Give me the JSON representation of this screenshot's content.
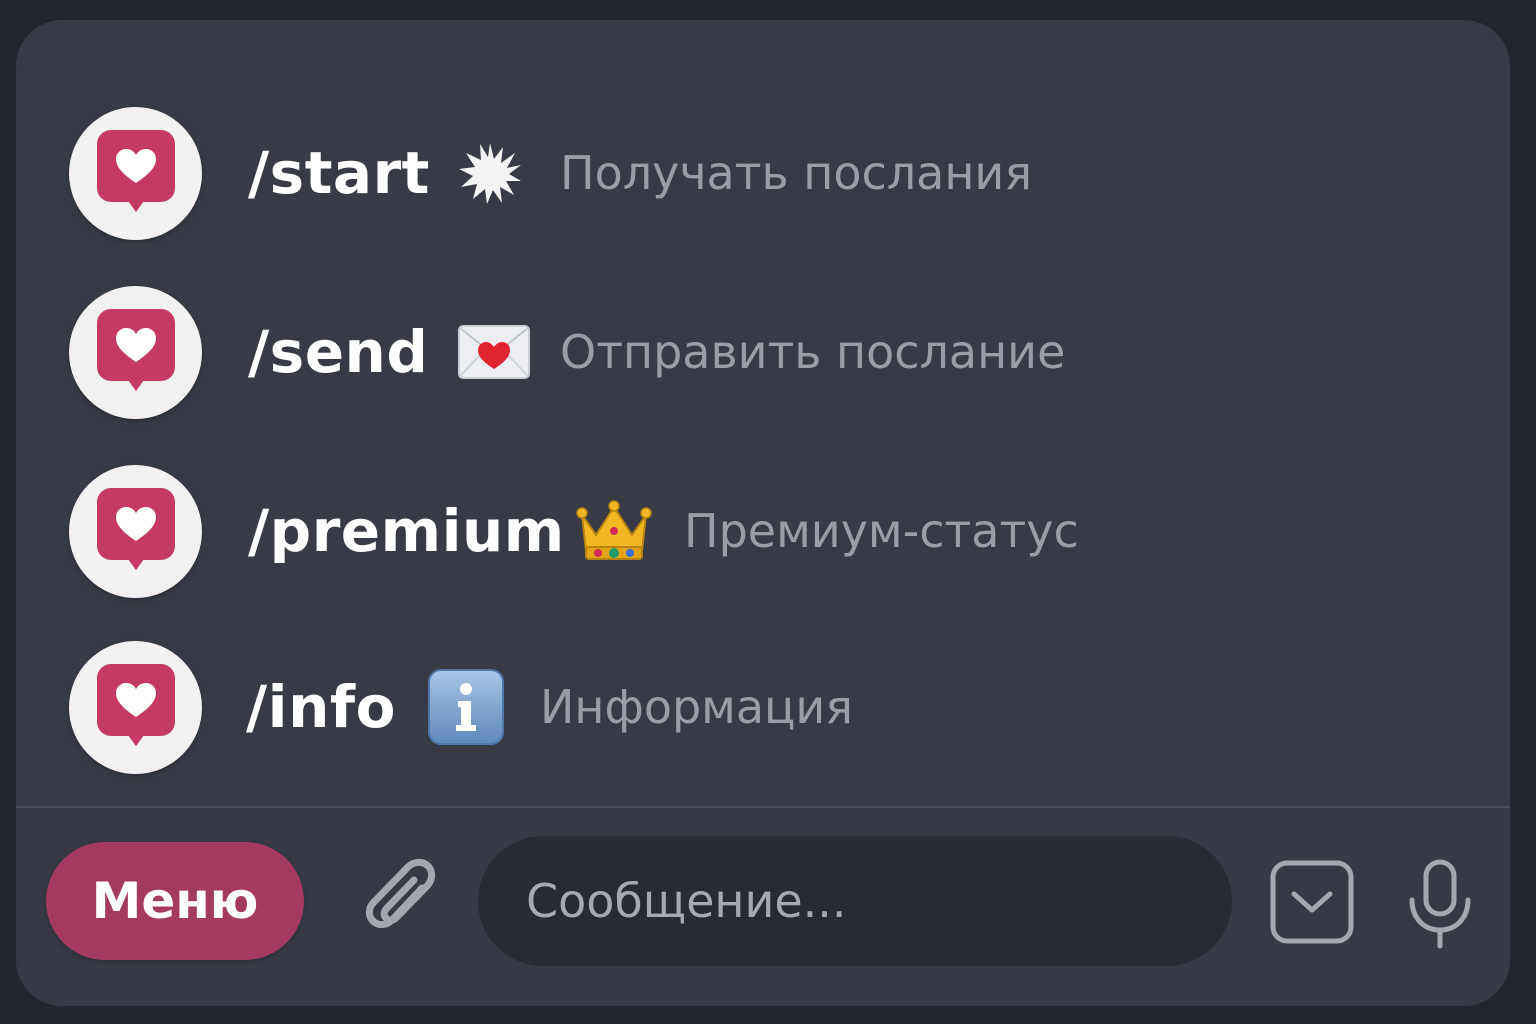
{
  "commands": [
    {
      "name": "/start",
      "emoji_icon": "sparkle-burst-icon",
      "description": "Получать послания"
    },
    {
      "name": "/send",
      "emoji_icon": "love-letter-icon",
      "description": "Отправить послание"
    },
    {
      "name": "/premium",
      "emoji_icon": "crown-icon",
      "description": "Премиум-статус"
    },
    {
      "name": "/info",
      "emoji_icon": "information-icon",
      "description": "Информация"
    }
  ],
  "avatar_icon": "heart-speech-bubble-icon",
  "bottom_bar": {
    "menu_label": "Меню",
    "input_placeholder": "Сообщение...",
    "input_value": "",
    "attach_icon": "paperclip-icon",
    "commands_toggle_icon": "chevron-down-square-icon",
    "mic_icon": "microphone-icon"
  },
  "colors": {
    "accent": "#a43a60",
    "avatar_bubble": "#c43a64",
    "panel": "#383b45",
    "input_bg": "#282b33",
    "command_text": "#ffffff",
    "description_text": "#9b9da6"
  }
}
